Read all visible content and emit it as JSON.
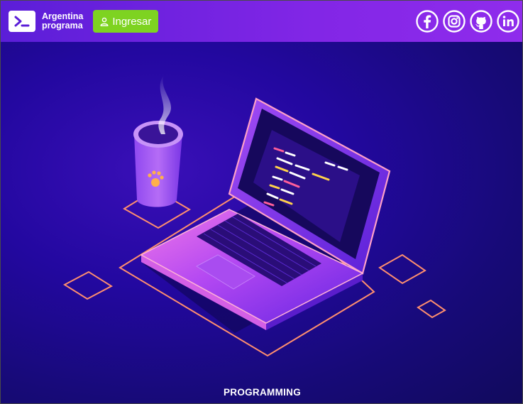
{
  "header": {
    "brand": {
      "line1": "Argentina",
      "line2": "programa"
    },
    "login_label": "Ingresar",
    "socials": [
      {
        "name": "facebook"
      },
      {
        "name": "instagram"
      },
      {
        "name": "github"
      },
      {
        "name": "linkedin"
      }
    ]
  },
  "hero": {
    "caption": "PROGRAMMING"
  },
  "colors": {
    "nav_start": "#5b1ed8",
    "nav_end": "#8f2cec",
    "login_green": "#7ed321",
    "hero_bg": "#1a0a86",
    "outline_orange": "#ff8a6a"
  },
  "icons": [
    "terminal-icon",
    "user-icon",
    "facebook-icon",
    "instagram-icon",
    "github-icon",
    "linkedin-icon"
  ]
}
